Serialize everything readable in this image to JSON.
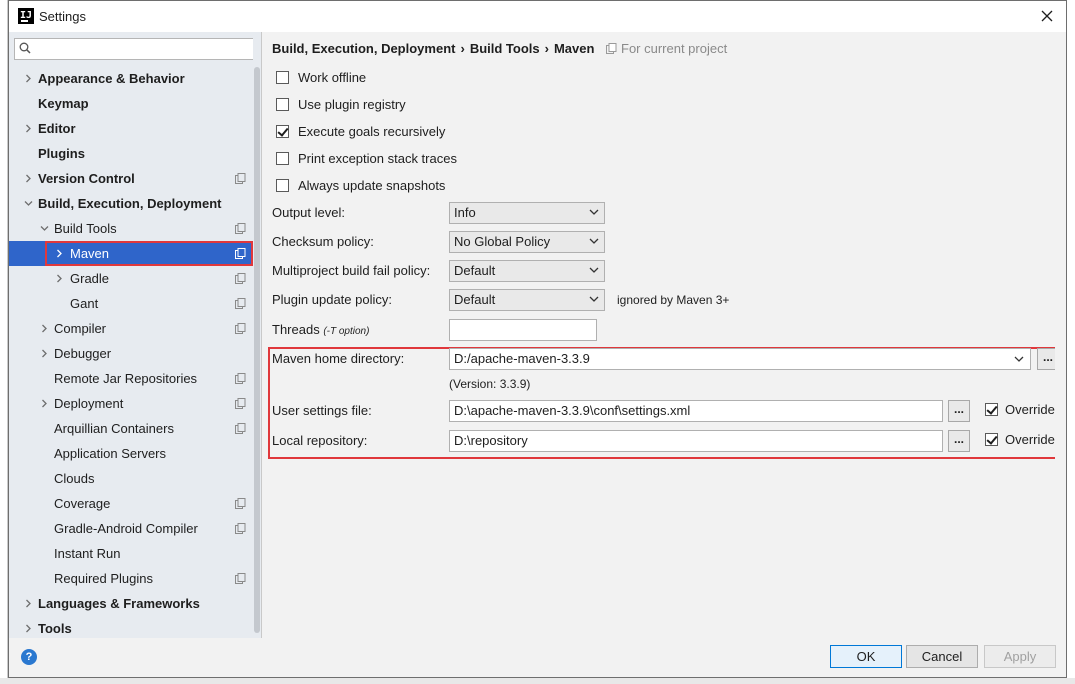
{
  "window": {
    "title": "Settings",
    "app_icon": "IJ"
  },
  "search": {
    "placeholder": "",
    "value": ""
  },
  "tree": [
    {
      "label": "Appearance & Behavior",
      "bold": true,
      "arrow": "right",
      "indent": 0,
      "project": false
    },
    {
      "label": "Keymap",
      "bold": true,
      "arrow": "",
      "indent": 0,
      "project": false
    },
    {
      "label": "Editor",
      "bold": true,
      "arrow": "right",
      "indent": 0,
      "project": false
    },
    {
      "label": "Plugins",
      "bold": true,
      "arrow": "",
      "indent": 0,
      "project": false
    },
    {
      "label": "Version Control",
      "bold": true,
      "arrow": "right",
      "indent": 0,
      "project": true
    },
    {
      "label": "Build, Execution, Deployment",
      "bold": true,
      "arrow": "down",
      "indent": 0,
      "project": false
    },
    {
      "label": "Build Tools",
      "bold": false,
      "arrow": "down",
      "indent": 1,
      "project": true
    },
    {
      "label": "Maven",
      "bold": false,
      "arrow": "right",
      "indent": 2,
      "project": true,
      "selected": true
    },
    {
      "label": "Gradle",
      "bold": false,
      "arrow": "right",
      "indent": 2,
      "project": true
    },
    {
      "label": "Gant",
      "bold": false,
      "arrow": "",
      "indent": 2,
      "project": true
    },
    {
      "label": "Compiler",
      "bold": false,
      "arrow": "right",
      "indent": 1,
      "project": true
    },
    {
      "label": "Debugger",
      "bold": false,
      "arrow": "right",
      "indent": 1,
      "project": false
    },
    {
      "label": "Remote Jar Repositories",
      "bold": false,
      "arrow": "",
      "indent": 1,
      "project": true
    },
    {
      "label": "Deployment",
      "bold": false,
      "arrow": "right",
      "indent": 1,
      "project": true
    },
    {
      "label": "Arquillian Containers",
      "bold": false,
      "arrow": "",
      "indent": 1,
      "project": true
    },
    {
      "label": "Application Servers",
      "bold": false,
      "arrow": "",
      "indent": 1,
      "project": false
    },
    {
      "label": "Clouds",
      "bold": false,
      "arrow": "",
      "indent": 1,
      "project": false
    },
    {
      "label": "Coverage",
      "bold": false,
      "arrow": "",
      "indent": 1,
      "project": true
    },
    {
      "label": "Gradle-Android Compiler",
      "bold": false,
      "arrow": "",
      "indent": 1,
      "project": true
    },
    {
      "label": "Instant Run",
      "bold": false,
      "arrow": "",
      "indent": 1,
      "project": false
    },
    {
      "label": "Required Plugins",
      "bold": false,
      "arrow": "",
      "indent": 1,
      "project": true
    },
    {
      "label": "Languages & Frameworks",
      "bold": true,
      "arrow": "right",
      "indent": 0,
      "project": false
    },
    {
      "label": "Tools",
      "bold": true,
      "arrow": "right",
      "indent": 0,
      "project": false
    }
  ],
  "breadcrumb": {
    "part1": "Build, Execution, Deployment",
    "part2": "Build Tools",
    "part3": "Maven",
    "separator": "›",
    "scope": "For current project"
  },
  "checkboxes": {
    "work_offline": {
      "label": "Work offline",
      "checked": false
    },
    "use_plugin_registry": {
      "label": "Use plugin registry",
      "checked": false
    },
    "execute_goals": {
      "label": "Execute goals recursively",
      "checked": true
    },
    "print_exception": {
      "label": "Print exception stack traces",
      "checked": false
    },
    "always_update": {
      "label": "Always update snapshots",
      "checked": false
    }
  },
  "form": {
    "output_level_label": "Output level:",
    "output_level_value": "Info",
    "checksum_label": "Checksum policy:",
    "checksum_value": "No Global Policy",
    "multiproject_label": "Multiproject build fail policy:",
    "multiproject_value": "Default",
    "plugin_update_label": "Plugin update policy:",
    "plugin_update_value": "Default",
    "plugin_update_note": "ignored by Maven 3+",
    "threads_label": "Threads",
    "threads_sub": "(-T option)",
    "threads_value": "",
    "maven_home_label": "Maven home directory:",
    "maven_home_value": "D:/apache-maven-3.3.9",
    "version": "(Version: 3.3.9)",
    "user_settings_label": "User settings file:",
    "user_settings_value": "D:\\apache-maven-3.3.9\\conf\\settings.xml",
    "local_repo_label": "Local repository:",
    "local_repo_value": "D:\\repository",
    "browse": "...",
    "override": "Override"
  },
  "buttons": {
    "ok": "OK",
    "cancel": "Cancel",
    "apply": "Apply",
    "help": "?"
  },
  "colors": {
    "selection": "#2f65ca",
    "highlight_outline": "#e0383c",
    "help": "#2a78d0"
  }
}
